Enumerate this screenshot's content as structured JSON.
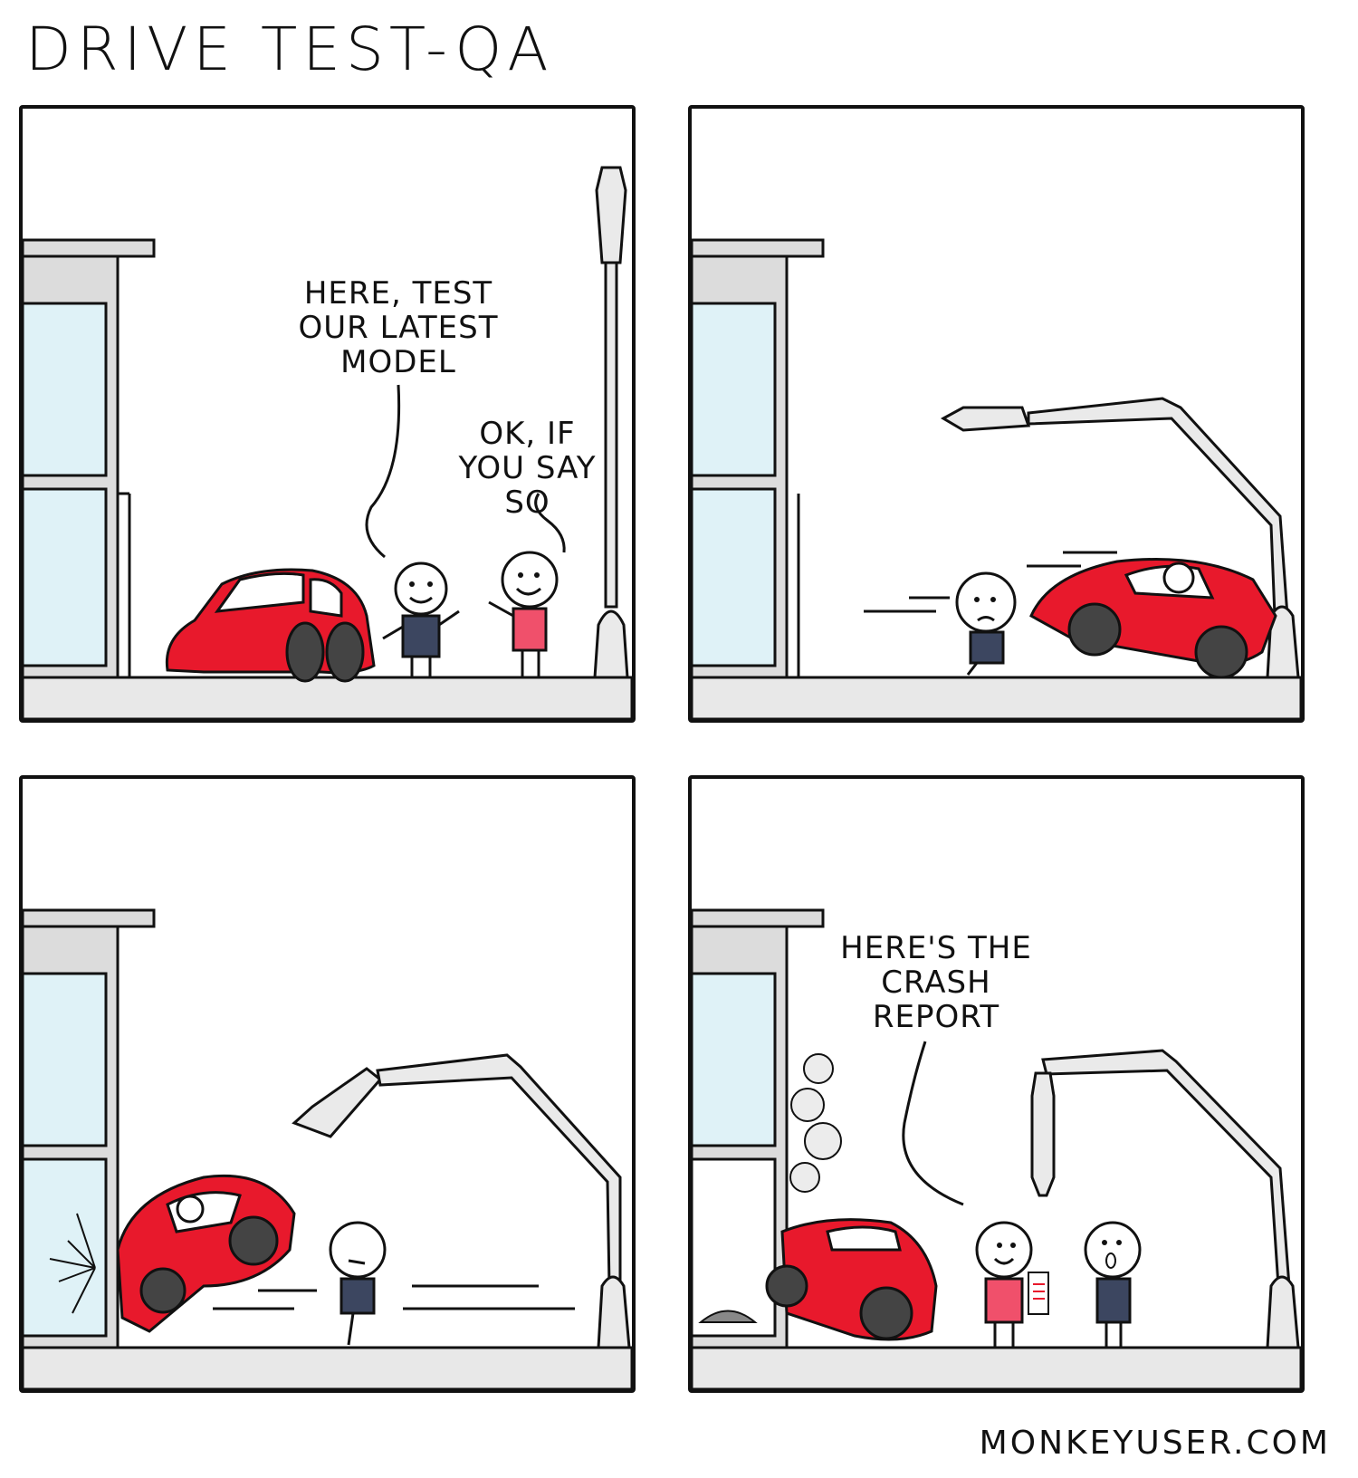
{
  "comic": {
    "title": "DRIVE TEST-QA",
    "site": "MONKEYUSER.COM",
    "accent_color": "#e8192c",
    "panels": [
      {
        "speech": [
          "HERE, TEST OUR LATEST MODEL",
          "OK, IF YOU SAY SO"
        ]
      },
      {
        "speech": []
      },
      {
        "speech": []
      },
      {
        "speech": [
          "HERE'S THE CRASH REPORT"
        ]
      }
    ]
  }
}
